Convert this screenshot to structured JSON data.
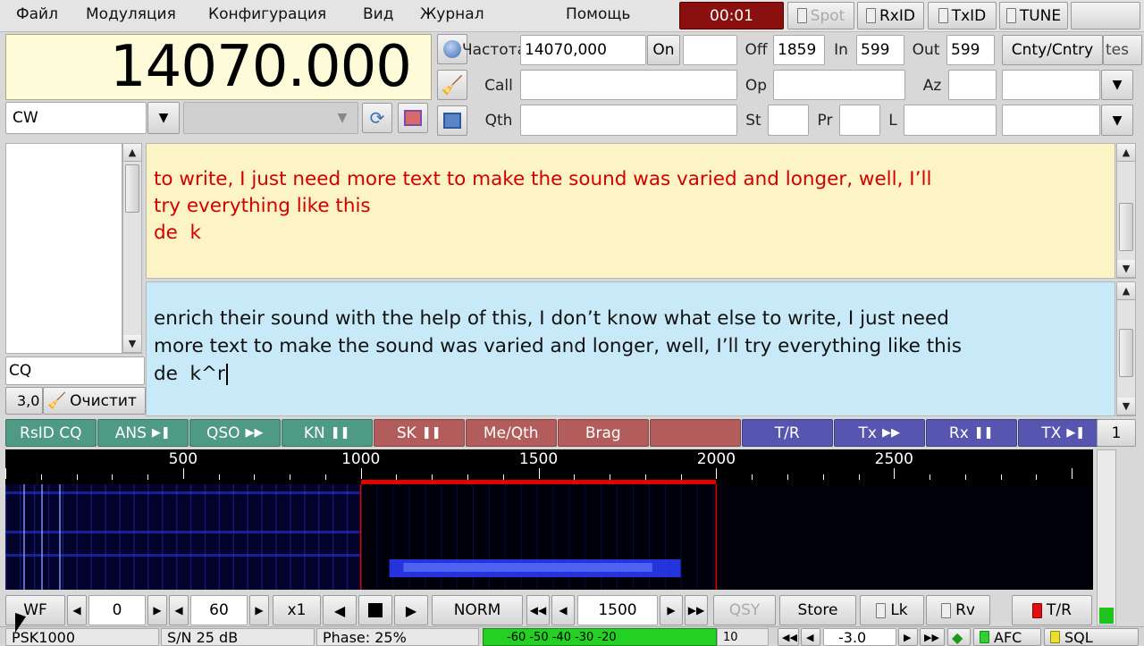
{
  "menu": [
    "Файл",
    "Модуляция",
    "Конфигурация",
    "Вид",
    "Журнал",
    "Помощь"
  ],
  "toolbar": {
    "timer": "00:01",
    "spot": "Spot",
    "rxid": "RxID",
    "txid": "TxID",
    "tune": "TUNE"
  },
  "frequency_display": "14070.000",
  "mode": "CW",
  "log": {
    "freq_label": "Частота",
    "freq_value": "14070,000",
    "on_label": "On",
    "on_value": "",
    "off_label": "Off",
    "off_value": "1859",
    "in_label": "In",
    "in_value": "599",
    "out_label": "Out",
    "out_value": "599",
    "cnty_label": "Cnty/Cntry",
    "tes_label": "tes",
    "call_label": "Call",
    "call_value": "",
    "op_label": "Op",
    "op_value": "",
    "az_label": "Az",
    "az_value": "",
    "qth_label": "Qth",
    "qth_value": "",
    "st_label": "St",
    "st_value": "",
    "pr_label": "Pr",
    "pr_value": "",
    "l_label": "L",
    "l_value": ""
  },
  "left_panel": {
    "cq_value": "CQ",
    "small_value": "3,0",
    "clear_label": "Очистит"
  },
  "rx_text": "to write, I just need more text to make the sound was varied and longer, well, I’ll\ntry everything like this\nde  k",
  "tx_text": "enrich their sound with the help of this, I don’t know what else to write, I just need\nmore text to make the sound was varied and longer, well, I’ll try everything like this\nde  k^r",
  "macros": [
    {
      "label": "RsID CQ",
      "icon": "",
      "color": "#4e9a84"
    },
    {
      "label": "ANS",
      "icon": "play-pause",
      "color": "#4e9a84"
    },
    {
      "label": "QSO",
      "icon": "fast-forward",
      "color": "#4e9a84"
    },
    {
      "label": "KN",
      "icon": "pause",
      "color": "#4e9a84"
    },
    {
      "label": "SK",
      "icon": "pause",
      "color": "#b35c5c"
    },
    {
      "label": "Me/Qth",
      "icon": "",
      "color": "#b35c5c"
    },
    {
      "label": "Brag",
      "icon": "",
      "color": "#b35c5c"
    },
    {
      "label": "",
      "icon": "",
      "color": "#b35c5c"
    },
    {
      "label": "T/R",
      "icon": "",
      "color": "#5656b0"
    },
    {
      "label": "Tx",
      "icon": "fast-forward",
      "color": "#5656b0"
    },
    {
      "label": "Rx",
      "icon": "pause",
      "color": "#5656b0"
    },
    {
      "label": "TX",
      "icon": "play-pause",
      "color": "#5656b0"
    }
  ],
  "macro_set": "1",
  "scale": {
    "labels": [
      "500",
      "1000",
      "1500",
      "2000",
      "2500"
    ],
    "min": 0,
    "max": 3060,
    "bandwidth_start": 1000,
    "bandwidth_end": 2000
  },
  "controls": {
    "wf_label": "WF",
    "offset_value": "0",
    "speed_value": "60",
    "zoom_label": "x1",
    "norm_label": "NORM",
    "carrier_value": "1500",
    "qsy_label": "QSY",
    "store_label": "Store",
    "lk_label": "Lk",
    "rv_label": "Rv",
    "tr_label": "T/R"
  },
  "status": {
    "mode_text": "PSK1000",
    "sn_text": "S/N 25 dB",
    "phase_text": "Phase: 25%",
    "meter_scale": "-60 -50 -40 -30 -20",
    "meter_end": "10",
    "squelch_value": "-3.0",
    "afc_label": "AFC",
    "sql_label": "SQL"
  },
  "colors": {
    "rx_text": "#d40000",
    "rx_bg": "#fcf4c4",
    "tx_bg": "#c8e9f8",
    "timer_bg": "#8a1010",
    "bandwidth_marker": "#e00000"
  }
}
